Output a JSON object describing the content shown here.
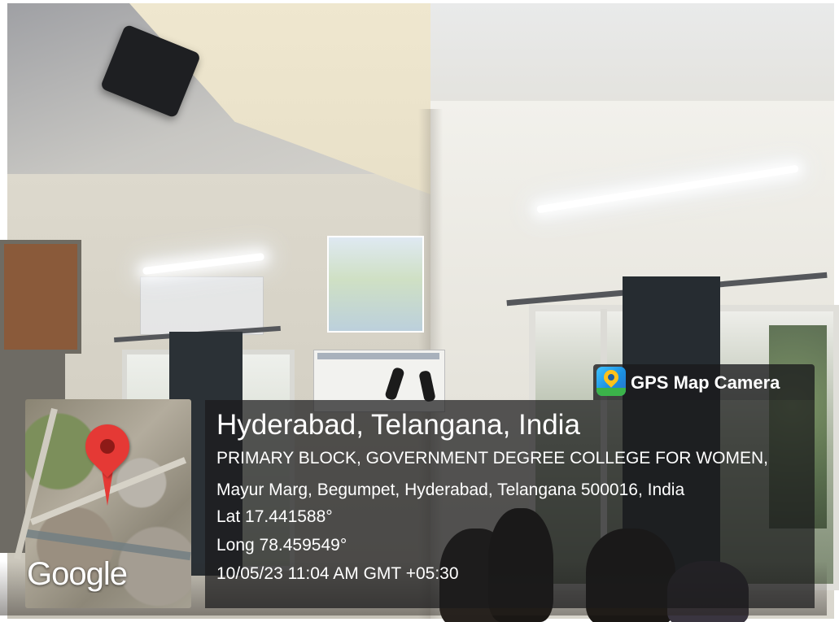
{
  "gps_stamp": {
    "app_label": "GPS Map Camera",
    "app_icon": "gps-map-camera-app-icon",
    "location_title": "Hyderabad, Telangana, India",
    "address_line_1": "PRIMARY BLOCK, GOVERNMENT DEGREE COLLEGE FOR WOMEN,",
    "address_line_2": "Mayur Marg, Begumpet, Hyderabad, Telangana 500016, India",
    "latitude": "Lat 17.441588°",
    "longitude": "Long 78.459549°",
    "datetime": "10/05/23 11:04 AM GMT +05:30",
    "map_watermark": "Google"
  },
  "colors": {
    "overlay_background": "#1a1a1c",
    "overlay_text": "#ffffff",
    "map_pin": "#e53935"
  }
}
